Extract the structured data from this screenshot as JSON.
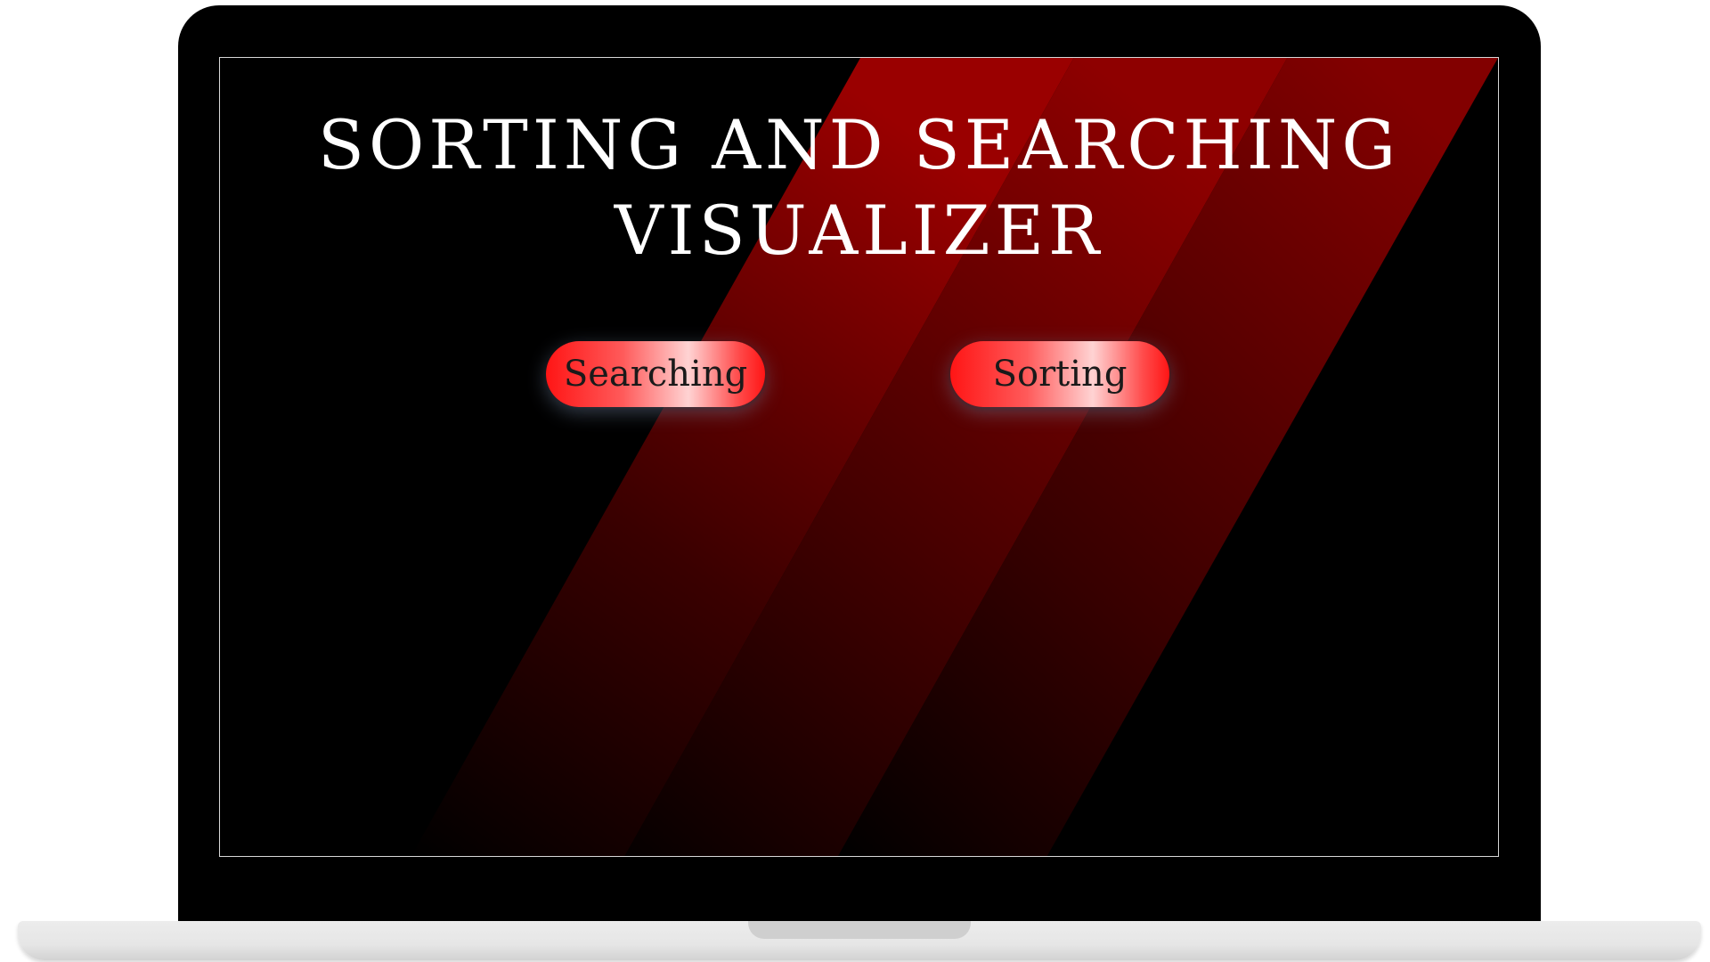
{
  "page": {
    "title_line_1": "SORTING AND SEARCHING",
    "title_line_2": "VISUALIZER"
  },
  "buttons": {
    "searching_label": "Searching",
    "sorting_label": "Sorting"
  },
  "colors": {
    "background": "#000000",
    "stripe_red": "#b00000",
    "button_red": "#ff1515",
    "title_text": "#ffffff",
    "button_text": "#1a1a1a"
  }
}
